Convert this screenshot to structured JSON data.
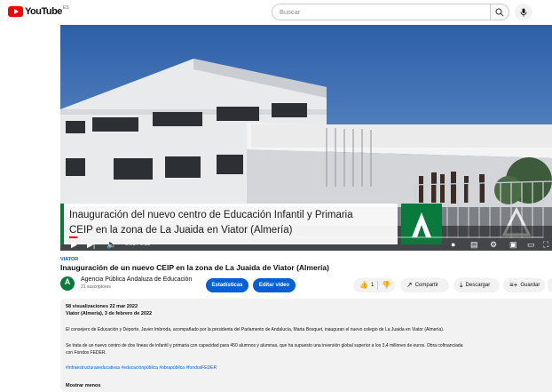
{
  "masthead": {
    "logo_text": "YouTube",
    "country_code": "ES",
    "search_placeholder": "Buscar",
    "search_icon": "search-icon",
    "mic_icon": "mic-icon"
  },
  "player": {
    "lower_third_line1": "Inauguración del nuevo centro de Educación Infantil y Primaria",
    "lower_third_line2": "CEIP en la zona de La Juaida en Viator (Almería)",
    "current_time": "0:01",
    "duration": "0:59",
    "progress": 0.017
  },
  "video": {
    "channel_tag": "VIATOR",
    "title": "Inauguración de un nuevo CEIP en la zona de La Juaida de Viator (Almería)"
  },
  "channel": {
    "name": "Agencia Pública Andaluza de Educación",
    "subscribers": "21 suscriptores",
    "avatar_letter": "A"
  },
  "actions": {
    "stats_label": "Estadísticas",
    "edit_label": "Editar vídeo",
    "like_count": "1",
    "share_label": "Compartir",
    "download_label": "Descargar",
    "save_label": "Guardar"
  },
  "description": {
    "meta": "58 visualizaciones  22 mar 2022",
    "location_date": "Viator (Almería), 3 de febrero de 2022",
    "paragraph1": "El consejero de Educación y Deporte, Javier Imbroda, acompañado por la presidenta del Parlamento de Andalucía, Marta Bosquet, inauguran el nuevo colegio de La Juaida en Viator (Almería).",
    "paragraph2_line1": "Se trata de un nuevo centro de dos líneas de infantil y primaria con capacidad para 450 alumnos y alumnas, que ha supuesto una inversión global superior a los 3,4 millones de euros. Obra cofinanciada",
    "paragraph2_line2": "con Fondos FEDER.",
    "hashtags": "#infraestructuraseducativas #educaciónpública #obrapública #fondosFEDER",
    "show_less": "Mostrar menos"
  },
  "colors": {
    "brand_red": "#ff0000",
    "link_blue": "#065fd4",
    "junta_green": "#0a7a3c"
  }
}
